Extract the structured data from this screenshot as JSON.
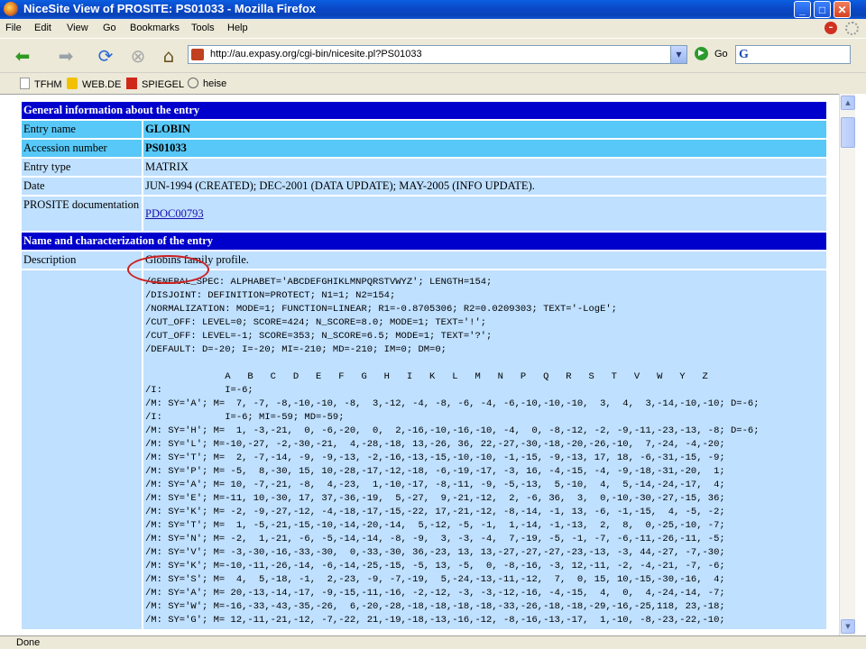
{
  "window": {
    "title": "NiceSite View of PROSITE: PS01033 - Mozilla Firefox",
    "minimize": "_",
    "maximize": "□",
    "close": "✕"
  },
  "menu": [
    "File",
    "Edit",
    "View",
    "Go",
    "Bookmarks",
    "Tools",
    "Help"
  ],
  "toolbar": {
    "url": "http://au.expasy.org/cgi-bin/nicesite.pl?PS01033",
    "go_label": "Go",
    "search_glyph": "G"
  },
  "bookmarks": [
    "TFHM",
    "WEB.DE",
    "SPIEGEL",
    "heise"
  ],
  "sections": {
    "general": "General information about the entry",
    "name_char": "Name and characterization of the entry"
  },
  "fields": {
    "entry_name_label": "Entry name",
    "entry_name": "GLOBIN",
    "accession_label": "Accession number",
    "accession": "PS01033",
    "entry_type_label": "Entry type",
    "entry_type": "MATRIX",
    "date_label": "Date",
    "date": "JUN-1994 (CREATED); DEC-2001 (DATA UPDATE); MAY-2005 (INFO UPDATE).",
    "doc_label": "PROSITE documentation",
    "doc_link": "PDOC00793",
    "description_label": "Description",
    "description": "Globins family profile."
  },
  "matrix_text": "/GENERAL_SPEC: ALPHABET='ABCDEFGHIKLMNPQRSTVWYZ'; LENGTH=154;\n/DISJOINT: DEFINITION=PROTECT; N1=1; N2=154;\n/NORMALIZATION: MODE=1; FUNCTION=LINEAR; R1=-0.8705306; R2=0.0209303; TEXT='-LogE';\n/CUT_OFF: LEVEL=0; SCORE=424; N_SCORE=8.0; MODE=1; TEXT='!';\n/CUT_OFF: LEVEL=-1; SCORE=353; N_SCORE=6.5; MODE=1; TEXT='?';\n/DEFAULT: D=-20; I=-20; MI=-210; MD=-210; IM=0; DM=0;\n\n              A   B   C   D   E   F   G   H   I   K   L   M   N   P   Q   R   S   T   V   W   Y   Z\n/I:           I=-6;\n/M: SY='A'; M=  7, -7, -8,-10,-10, -8,  3,-12, -4, -8, -6, -4, -6,-10,-10,-10,  3,  4,  3,-14,-10,-10; D=-6;\n/I:           I=-6; MI=-59; MD=-59;\n/M: SY='H'; M=  1, -3,-21,  0, -6,-20,  0,  2,-16,-10,-16,-10, -4,  0, -8,-12, -2, -9,-11,-23,-13, -8; D=-6;\n/M: SY='L'; M=-10,-27, -2,-30,-21,  4,-28,-18, 13,-26, 36, 22,-27,-30,-18,-20,-26,-10,  7,-24, -4,-20;\n/M: SY='T'; M=  2, -7,-14, -9, -9,-13, -2,-16,-13,-15,-10,-10, -1,-15, -9,-13, 17, 18, -6,-31,-15, -9;\n/M: SY='P'; M= -5,  8,-30, 15, 10,-28,-17,-12,-18, -6,-19,-17, -3, 16, -4,-15, -4, -9,-18,-31,-20,  1;\n/M: SY='A'; M= 10, -7,-21, -8,  4,-23,  1,-10,-17, -8,-11, -9, -5,-13,  5,-10,  4,  5,-14,-24,-17,  4;\n/M: SY='E'; M=-11, 10,-30, 17, 37,-36,-19,  5,-27,  9,-21,-12,  2, -6, 36,  3,  0,-10,-30,-27,-15, 36;\n/M: SY='K'; M= -2, -9,-27,-12, -4,-18,-17,-15,-22, 17,-21,-12, -8,-14, -1, 13, -6, -1,-15,  4, -5, -2;\n/M: SY='T'; M=  1, -5,-21,-15,-10,-14,-20,-14,  5,-12, -5, -1,  1,-14, -1,-13,  2,  8,  0,-25,-10, -7;\n/M: SY='N'; M= -2,  1,-21, -6, -5,-14,-14, -8, -9,  3, -3, -4,  7,-19, -5, -1, -7, -6,-11,-26,-11, -5;\n/M: SY='V'; M= -3,-30,-16,-33,-30,  0,-33,-30, 36,-23, 13, 13,-27,-27,-27,-23,-13, -3, 44,-27, -7,-30;\n/M: SY='K'; M=-10,-11,-26,-14, -6,-14,-25,-15, -5, 13, -5,  0, -8,-16, -3, 12,-11, -2, -4,-21, -7, -6;\n/M: SY='S'; M=  4,  5,-18, -1,  2,-23, -9, -7,-19,  5,-24,-13,-11,-12,  7,  0, 15, 10,-15,-30,-16,  4;\n/M: SY='A'; M= 20,-13,-14,-17, -9,-15,-11,-16, -2,-12, -3, -3,-12,-16, -4,-15,  4,  0,  4,-24,-14, -7;\n/M: SY='W'; M=-16,-33,-43,-35,-26,  6,-20,-28,-18,-18,-18,-18,-33,-26,-18,-18,-29,-16,-25,118, 23,-18;\n/M: SY='G'; M= 12,-11,-21,-12, -7,-22, 21,-19,-18,-13,-16,-12, -8,-16,-13,-17,  1,-10, -8,-23,-22,-10;",
  "status": "Done",
  "icons": {
    "back": "back-arrow-icon",
    "forward": "forward-arrow-icon",
    "reload": "reload-icon",
    "stop": "stop-icon",
    "home": "home-icon",
    "go": "go-icon"
  }
}
